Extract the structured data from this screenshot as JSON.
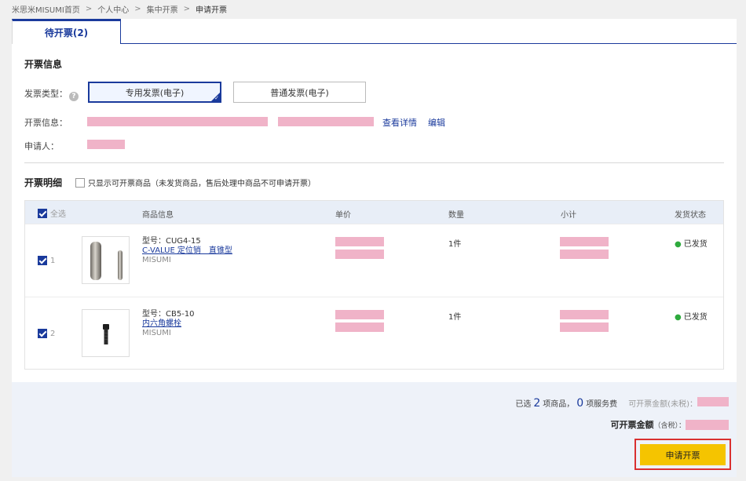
{
  "breadcrumb": [
    "米思米MISUMI首页",
    "个人中心",
    "集中开票",
    "申请开票"
  ],
  "tab_label": "待开票(2)",
  "invoice_info": {
    "section_title": "开票信息",
    "type_label": "发票类型：",
    "type_options": [
      "专用发票(电子)",
      "普通发票(电子)"
    ],
    "selected_type": "专用发票(电子)",
    "info_label": "开票信息：",
    "view_detail": "查看详情",
    "edit": "编辑",
    "applicant_label": "申请人："
  },
  "details": {
    "section_title": "开票明细",
    "filter_label": "只显示可开票商品（未发货商品，售后处理中商品不可申请开票）",
    "filter_checked": false
  },
  "table": {
    "select_all": "全选",
    "headers": [
      "商品信息",
      "单价",
      "数量",
      "小计",
      "发货状态"
    ],
    "rows": [
      {
        "index": "1",
        "checked": true,
        "model": "型号：CUG4-15",
        "name": "C-VALUE 定位销　直锥型",
        "brand": "MISUMI",
        "qty": "1件",
        "status": "已发货"
      },
      {
        "index": "2",
        "checked": true,
        "model": "型号：CB5-10",
        "name": "内六角螺栓",
        "brand": "MISUMI",
        "qty": "1件",
        "status": "已发货"
      }
    ]
  },
  "summary": {
    "selected_prefix": "已选",
    "selected_count": "2",
    "items_suffix": "项商品，",
    "service_count": "0",
    "service_suffix": "项服务费",
    "pre_tax_label": "可开票金额(未税)：",
    "total_label": "可开票金额",
    "tax_note": "（含税）："
  },
  "apply_button": "申请开票",
  "colors": {
    "brand_blue": "#1a3a9c",
    "accent_yellow": "#f5c400",
    "status_green": "#2eaa3d",
    "highlight_red": "#d93030"
  }
}
